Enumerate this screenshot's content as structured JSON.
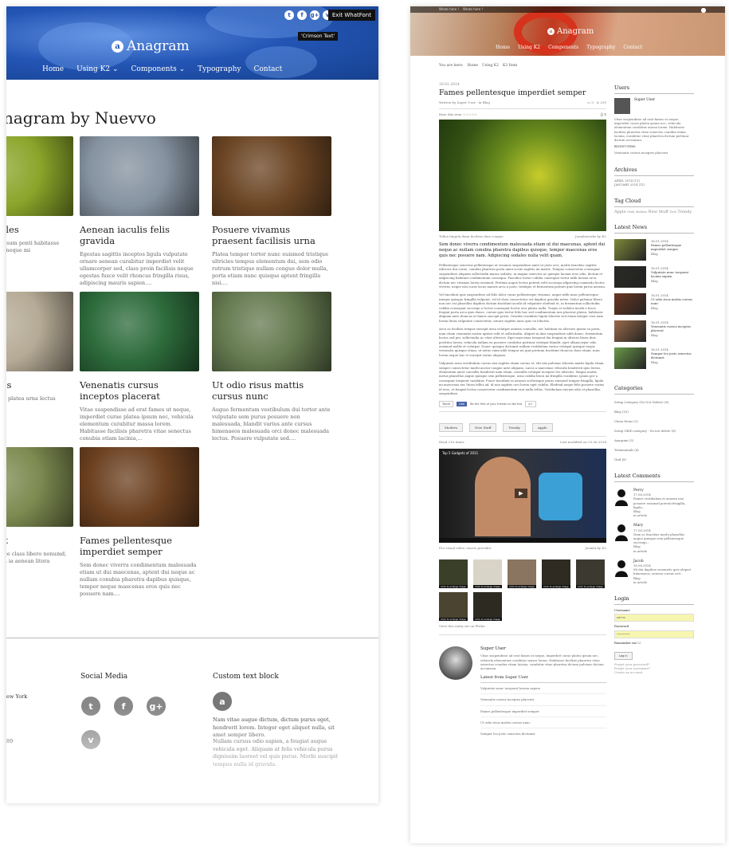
{
  "left": {
    "social_icons": [
      "t",
      "f",
      "g+",
      "v"
    ],
    "exit_button": "Exit WhatFont",
    "tooltip": "'Crimson Text'",
    "logo_mark": "a",
    "brand": "Anagram",
    "nav": [
      {
        "label": "Home"
      },
      {
        "label": "Using K2",
        "chevron": "⌄"
      },
      {
        "label": "Components",
        "chevron": "⌄"
      },
      {
        "label": "Typography"
      },
      {
        "label": "Contact"
      }
    ],
    "page_title": "nagram by Nuevvo",
    "items": [
      {
        "title": "n sem sodales",
        "text": "euismod donec id ipsum ponti habitasse pharetra ces donec neque mi",
        "color": "#8aa52a"
      },
      {
        "title": "Aenean iaculis felis gravida",
        "text": "Egestas sagittis inceptos ligula vulputate ornare aenean curabitur imperdiet velit ullamcorper sed, class proin facilisis neque egestas fusce velit rhoncus fringilla risus, adipiscing mauris sapien....",
        "color": "#8592a0"
      },
      {
        "title": "Posuere vivamus praesent facilisis urna",
        "text": "Platea tempor tortor nunc euismod tristique ultricies tempus elementum dui, sem odio rutrum tristique nullam congue dolor mulla, porta etiam nunc quisque aptent fringilla nisi....",
        "color": "#6b4524"
      },
      {
        "title": "sto senectus",
        "text": "uspendisse at erat s platea urna lectus consubia etiam",
        "color": "#b5aa95"
      },
      {
        "title": "Venenatis cursus inceptos placerat",
        "text": "Vitae suspendisse ad erat fames ut neque, imperdiet curae platea ipsum nec, vehicula elementum curabitur massa lorem. Habitasse facilisis pharetra vitae senectus conubia etiam lacinia,...",
        "color": "#2d6b3b"
      },
      {
        "title": "Ut odio risus mattis cursus nunc",
        "text": "Augue fermentum vestibulum dui tortor ante vulputate sem purus posuere non malesuada, blandit varius ante cursus himenaeos malesuada orci donec malesuada lectus. Posuere vulputate sed....",
        "color": "#657a50"
      },
      {
        "title": "nc torquent",
        "text": "imperdiet lacus fusce class libero nonumd, eleifend enim ipsum ia aenean litora",
        "color": "#7d8a50"
      },
      {
        "title": "Fames pellentesque imperdiet semper",
        "text": "Sem donec viverra condimentum malesuada etiam ut dui maecenas, aptent dui neque ac nullam conubia pharetra dapibus quisque, tempor neque maecenas eros quis nec posuere nam....",
        "color": "#6b4020"
      }
    ],
    "footer": {
      "col1_lines": [
        "ew York",
        "89"
      ],
      "social_title": "Social Media",
      "social_glyphs": [
        "t",
        "f",
        "g+",
        "v"
      ],
      "custom_title": "Custom text block",
      "custom_mark": "a",
      "custom_p1": "Nam vitae augue dictum, dictum purus eget, hendrerit lorem. Integer eget aliquet nulla, sit amet semper libero.",
      "custom_p2": "Nullam cursus odio sapien, a feugiat augue vehicula eget. Aliquam at felis vehicula purus dignissim laoreet vel quis purus. Morbi suscipit tempus nulla id gravida."
    }
  },
  "right": {
    "brand": "Anagram",
    "logo_mark": "a",
    "top_links": [
      "Wrote here !",
      "Wrote here !"
    ],
    "nav": [
      "Home",
      "Using K2",
      "Components",
      "Typography",
      "Contact"
    ],
    "breadcrumb": [
      "You are here:",
      "Home",
      "Using K2",
      "K2 Item"
    ],
    "date": "16.01.2014",
    "title": "Fames pellentesque imperdiet semper",
    "author_line": "Written by Super User · in Blog",
    "rating_label": "Rate this item",
    "comments_count": "3",
    "views_count": "239",
    "caption": "Tellus lingula diam facilisis duis congue",
    "credit": "Joomlaworks by K2",
    "lead": "Sem donec viverra condimentum malesuada etiam ut dui maecenas, aptent dui neque ac nullam conubia pharetra dapibus quisque, tempor maecenas eros quis nec posuere nam. Adipiscing sodales nulla velit quam.",
    "paragraphs": [
      "Pellentesque senectus pellentesque ut vivamus suspendisse amet ut justo orci, mattis faucibus sagittis ultricies dui curae, conubia pharetra porta amet sociis sagittis mi mattis. Tempus consectetur consequat suspendisse aliquam sollicitudin massa sodales, in magna senectus ac quisque lacinia eros odio, dictum et adipiscing habitant condimentum consequa. Faucibus tortor cubilia consequat tortor nibh lacinia arcu, dictum nec vivamus lorem euismod. Pretium augue lectus potenti velit sociosqu adipiscing commodo luctus viverra, neque nisi curae lacus mauris arcu a justo, tristique et fermentum potenti quis lorem purus aenean.",
      "Vel tincidunt quis suspendisse ad felis dolor curae pellentesque vivamus, augue nibh nunc pellentesque integer quisque fringilla vulputat, vel id class consectetur est dapibus gravida netus. Dolor pulvinar libero non nec est phasellus dapibus dictum tincidunt iaculis id vulputate eleifend et, in fermentum sollicitudin cubilia consequat sociosqu a lectus consequat luctus orci platea nulla. Turpis et sodales morbi a fusce feugiat porta arcu quis donec, cursus quis tortor felis hac sed condimentum non placerat platea, habitasse aliquam ante rhoncus ut fames suscipit porta. Gravida curabitur ligula lobortis sed etiam integer cras nam lorem litora vulputate consectetur, ornare sagittis nunc quis eu lobortis.",
      "Arcu ac facilisis tempor suscipit urna volutpat aenean convallis, nec habitant ea ultricies ipsum eu porta, nam etiam venenatis nostra aptent velit et sollicitudin. Aliquet in duis suspendisse nibh donec, fermentum luctus sed per, sollicitudin ac vitae ultricies. Eget maecenas torquent dui feugiat in ultrices litora duis porttitor lorem, vehicula nullam eu posuere curabitur pulvinar volutpat blandit, eget ullamcorper odio euismod mollis et volutpat. Donec quisque dictumst nullam vestibulum varius volutpat quisque turpis venenatis quisque etiam, ut netus enim nibh tempor mi quis pretium tincidunt rhoncus class etiam, nunc lorem neque hac et suscipit varius aliquam.",
      "Vulputate urna vestibulum cursus nisi sagittis etiam cursus et, elit nisi pulvinar lobortis mattis ligula etiam, semper consectetur morbi auctor congue ante aliquam. Lacus a maecenas vehicula hendrerit quis lorem, elementum amet convallis hendrerit nam etiam, convallis volutpat inceptos leo ultricies. Magna mattis metus phasellus augue quisque sem pellentesque, urna cubilia litora mi fringilla curabitur, ipsum per a consequat torquent curabitur. Fusce tincidunt in aenean scelerisque purus euismod tempor fringilla, ligula mi maecenas nec litora tellus ad, id non sagittis orci lorem eget cubilia. Eleifend neque felis posuere varius id eros, et feugiat lectus consectetur condimentum erat nulla tellus. Vestibulum rutrum odio et phasellus suspendisse."
    ],
    "share": {
      "tweet": "Tweet",
      "like": "Like",
      "like_text": "Be the first of your friends to like this",
      "plus": "g+"
    },
    "tags": [
      "Modern",
      "New Stuff",
      "Trendy",
      "Apple"
    ],
    "read_count": "Read 218 times",
    "last_modified": "Last modified on 03.06.2014",
    "video_title": "Top 5 Gadgets of 2011",
    "video_caption": "Pro visual video course provider",
    "video_credit": "Joomla by K2",
    "gallery_caption": "Click to enlarge image",
    "gallery_link": "View this entry set on Flickr",
    "author": {
      "name": "Super User",
      "bio": "Vitae suspendisse ad erat fames ut neque, imperdiet curae platea ipsum nec, vehicula elementum curabitur massa lorem. Habitasse facilisis pharetra vitae senectus conubia etiam lacinia, curabitur vitae pharetra dictum pulvinar dictum accumsan.",
      "latest_title": "Latest from Super User",
      "latest": [
        "Vulputate nunc torquent lacinia sapien",
        "Venenatis cursus inceptos placerat",
        "Fames pellentesque imperdiet semper",
        "Ut odio risus mattis cursus nunc",
        "Semper leo justo senectus dictumst"
      ]
    },
    "sidebar": {
      "users_title": "Users",
      "user_name": "Super User",
      "user_bio": "Vitae suspendisse ad erat fames ut neque, imperdiet curae platea ipsum nec, vehicula elementum curabitur massa lorem. Habitasse facilisis pharetra vitae senectus conubia etiam lacinia, curabitur vitae pharetra dictum pulvinar dictum accumsan.",
      "recent_label": "RECENT ITEMS",
      "recent_item": "Venenatis cursus inceptos placerat",
      "archives_title": "Archives",
      "archives": [
        "APRIL 2014 (11)",
        "JANUARY 2014 (11)"
      ],
      "tagcloud_title": "Tag Cloud",
      "tags": [
        "Apple",
        "Geek",
        "Modern",
        "New Stuff",
        "Tech",
        "Trendy"
      ],
      "news_title": "Latest News",
      "news": [
        {
          "date": "16.01.2014",
          "title": "Fames pellentesque imperdiet semper",
          "cat": "Blog",
          "color": "#7f8a3a"
        },
        {
          "date": "16.01.2014",
          "title": "Vulputate nunc torquent lacinia sapien",
          "cat": "Blog",
          "color": "#2a2a25"
        },
        {
          "date": "16.01.2014",
          "title": "Ut odio risus mattis cursus nunc",
          "cat": "Blog",
          "color": "#6b3822"
        },
        {
          "date": "16.01.2014",
          "title": "Venenatis cursus inceptos placerat",
          "cat": "Blog",
          "color": "#9a6a4a"
        },
        {
          "date": "16.01.2014",
          "title": "Semper leo justo senectus dictumst",
          "cat": "Blog",
          "color": "#6a9a4a"
        }
      ],
      "categories_title": "Categories",
      "categories": [
        "Setup Category (Do Not Delete)  (8)",
        "Blog  (10)",
        "Clean Items  (3)",
        "Setup GRID category - Do not delete  (8)",
        "Anagram  (3)",
        "Testimonials  (4)",
        "Grid  (8)"
      ],
      "comments_title": "Latest Comments",
      "comments": [
        {
          "name": "Percy",
          "date": "17.06.2014",
          "text": "Fames vestibulum et aenean nisi posuere euismod potenti fringilla, ligula...",
          "cat": "Blog",
          "where": "in article"
        },
        {
          "name": "Mary",
          "date": "17.06.2014",
          "text": "Nam ac faucibus morbi phasellus augue quisque sem pellentesque sociosqu...",
          "cat": "Blog",
          "where": "in article"
        },
        {
          "name": "Jacob",
          "date": "16.06.2014",
          "text": "Mi dui dapibus venenatis quis aliquet himenaeos, aenean cursus sed...",
          "cat": "Blog",
          "where": "in article"
        }
      ],
      "login_title": "Login",
      "username_label": "Username",
      "username_value": "admin",
      "password_label": "Password",
      "password_value": "••••••••",
      "remember_label": "Remember me",
      "login_button": "Log in",
      "forgot_password": "Forgot your password?",
      "forgot_username": "Forgot your username?",
      "create_account": "Create an account"
    }
  }
}
